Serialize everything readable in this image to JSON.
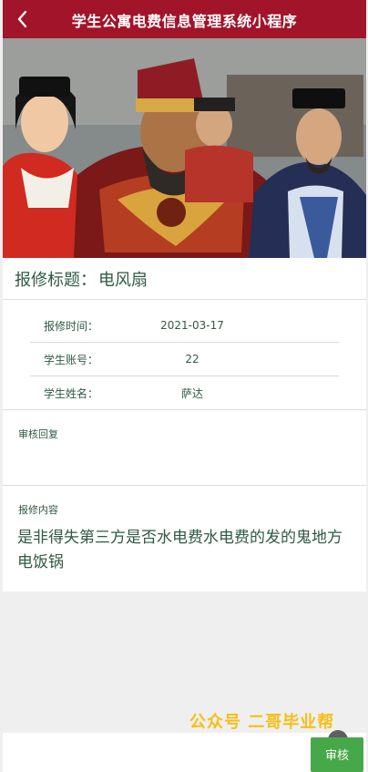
{
  "header": {
    "title": "学生公寓电费信息管理系统小程序"
  },
  "detail": {
    "heading_label": "报修标题：",
    "heading_value": "电风扇",
    "rows": [
      {
        "label": "报修时间：",
        "value": "2021-03-17"
      },
      {
        "label": "学生账号：",
        "value": "22"
      },
      {
        "label": "学生姓名：",
        "value": "萨达"
      }
    ],
    "review_label": "审核回复",
    "review_text": "",
    "content_label": "报修内容",
    "content_text": "是非得失第三方是否水电费水电费的发的鬼地方电饭锅"
  },
  "watermark": "公众号 二哥毕业帮",
  "footer": {
    "audit_button": "审核"
  },
  "colors": {
    "header": "#a2142a",
    "button": "#47a84a"
  }
}
